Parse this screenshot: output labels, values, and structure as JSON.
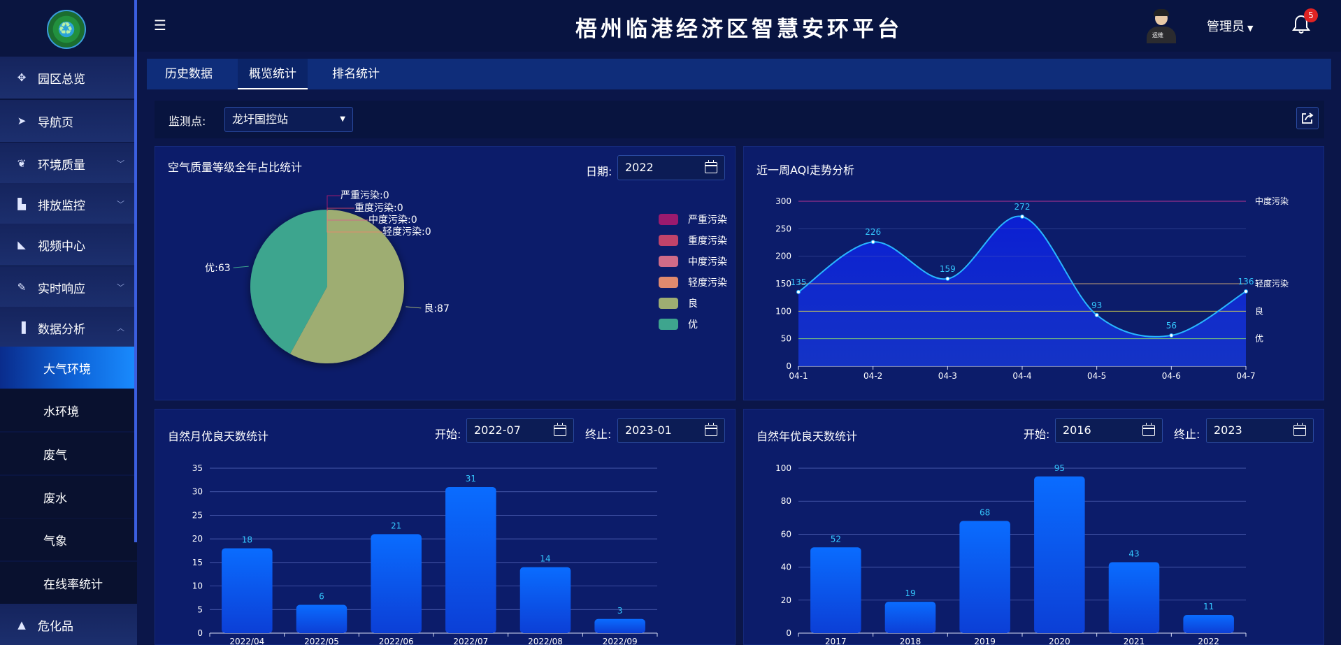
{
  "app": {
    "title": "梧州临港经济区智慧安环平台"
  },
  "header": {
    "user_name": "管理员",
    "notification_count": "5",
    "avatar_tag": "运维"
  },
  "sidebar": {
    "items": [
      {
        "label": "园区总览",
        "icon": "grid-icon"
      },
      {
        "label": "导航页",
        "icon": "send-icon"
      },
      {
        "label": "环境质量",
        "icon": "leaf-icon"
      },
      {
        "label": "排放监控",
        "icon": "factory-icon"
      },
      {
        "label": "视频中心",
        "icon": "camera-icon"
      },
      {
        "label": "实时响应",
        "icon": "edit-icon"
      },
      {
        "label": "数据分析",
        "icon": "bar-chart-icon"
      }
    ],
    "sub_items": [
      "大气环境",
      "水环境",
      "废气",
      "废水",
      "气象",
      "在线率统计"
    ],
    "bottom_item": {
      "label": "危化品",
      "icon": "warning-icon"
    }
  },
  "tabs": [
    "历史数据",
    "概览统计",
    "排名统计"
  ],
  "filter": {
    "label": "监测点:",
    "value": "龙圩国控站"
  },
  "panels": {
    "pie": {
      "title": "空气质量等级全年占比统计",
      "date_label": "日期:",
      "date_value": "2022"
    },
    "aqi": {
      "title": "近一周AQI走势分析"
    },
    "monthly": {
      "title": "自然月优良天数统计",
      "start_label": "开始:",
      "start_value": "2022-07",
      "end_label": "终止:",
      "end_value": "2023-01"
    },
    "yearly": {
      "title": "自然年优良天数统计",
      "start_label": "开始:",
      "start_value": "2016",
      "end_label": "终止:",
      "end_value": "2023"
    }
  },
  "chart_data": [
    {
      "type": "pie",
      "title": "空气质量等级全年占比统计",
      "slices": [
        {
          "name": "严重污染",
          "value": 0,
          "color": "#9b1a6e",
          "label": "严重污染:0"
        },
        {
          "name": "重度污染",
          "value": 0,
          "color": "#c1436a",
          "label": "重度污染:0"
        },
        {
          "name": "中度污染",
          "value": 0,
          "color": "#d06b88",
          "label": "中度污染:0"
        },
        {
          "name": "轻度污染",
          "value": 0,
          "color": "#e08a6e",
          "label": "轻度污染:0"
        },
        {
          "name": "良",
          "value": 87,
          "color": "#9ead72",
          "label": "良:87"
        },
        {
          "name": "优",
          "value": 63,
          "color": "#3ea58e",
          "label": "优:63"
        }
      ],
      "legend": [
        "严重污染",
        "重度污染",
        "中度污染",
        "轻度污染",
        "良",
        "优"
      ],
      "legend_colors": [
        "#9b1a6e",
        "#c1436a",
        "#d06b88",
        "#e08a6e",
        "#9ead72",
        "#3ea58e"
      ]
    },
    {
      "type": "area",
      "title": "近一周AQI走势分析",
      "categories": [
        "04-1",
        "04-2",
        "04-3",
        "04-4",
        "04-5",
        "04-6",
        "04-7"
      ],
      "values": [
        135,
        226,
        159,
        272,
        93,
        56,
        136
      ],
      "ylim": [
        0,
        300
      ],
      "yticks": [
        0,
        50,
        100,
        150,
        200,
        250,
        300
      ],
      "thresholds": [
        {
          "value": 300,
          "label": "中度污染",
          "color": "#d63a9a"
        },
        {
          "value": 150,
          "label": "轻度污染",
          "color": "#e6b87a"
        },
        {
          "value": 100,
          "label": "良",
          "color": "#e5e04a"
        },
        {
          "value": 50,
          "label": "优",
          "color": "#8ee06a"
        }
      ],
      "line_color": "#29b6ff"
    },
    {
      "type": "bar",
      "title": "自然月优良天数统计",
      "categories": [
        "2022/04",
        "2022/05",
        "2022/06",
        "2022/07",
        "2022/08",
        "2022/09"
      ],
      "values": [
        18,
        6,
        21,
        31,
        14,
        3
      ],
      "ylim": [
        0,
        35
      ],
      "yticks": [
        0,
        5,
        10,
        15,
        20,
        25,
        30,
        35
      ]
    },
    {
      "type": "bar",
      "title": "自然年优良天数统计",
      "categories": [
        "2017",
        "2018",
        "2019",
        "2020",
        "2021",
        "2022"
      ],
      "values": [
        52,
        19,
        68,
        95,
        43,
        11
      ],
      "ylim": [
        0,
        100
      ],
      "yticks": [
        0,
        20,
        40,
        60,
        80,
        100
      ]
    }
  ]
}
